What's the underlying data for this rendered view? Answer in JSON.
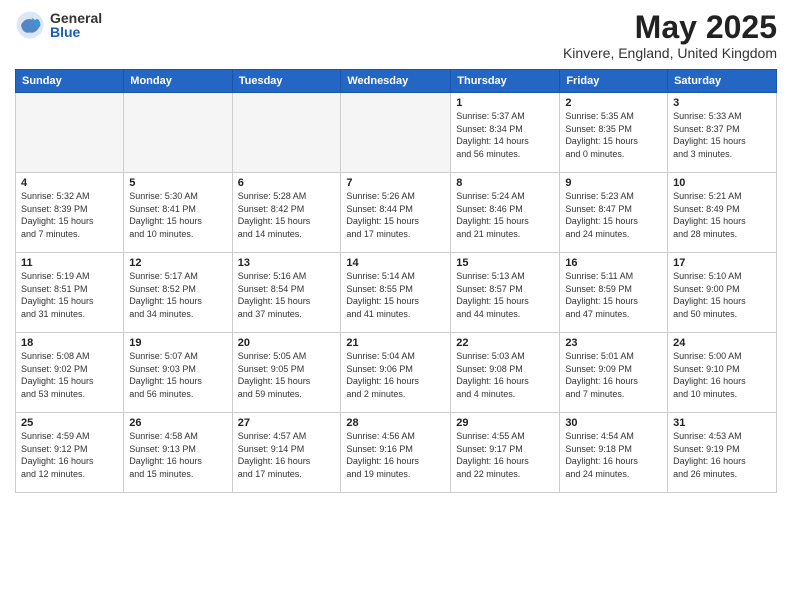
{
  "logo": {
    "general": "General",
    "blue": "Blue"
  },
  "title": {
    "month_year": "May 2025",
    "location": "Kinvere, England, United Kingdom"
  },
  "weekdays": [
    "Sunday",
    "Monday",
    "Tuesday",
    "Wednesday",
    "Thursday",
    "Friday",
    "Saturday"
  ],
  "weeks": [
    [
      {
        "day": "",
        "info": "",
        "empty": true
      },
      {
        "day": "",
        "info": "",
        "empty": true
      },
      {
        "day": "",
        "info": "",
        "empty": true
      },
      {
        "day": "",
        "info": "",
        "empty": true
      },
      {
        "day": "1",
        "info": "Sunrise: 5:37 AM\nSunset: 8:34 PM\nDaylight: 14 hours\nand 56 minutes.",
        "empty": false
      },
      {
        "day": "2",
        "info": "Sunrise: 5:35 AM\nSunset: 8:35 PM\nDaylight: 15 hours\nand 0 minutes.",
        "empty": false
      },
      {
        "day": "3",
        "info": "Sunrise: 5:33 AM\nSunset: 8:37 PM\nDaylight: 15 hours\nand 3 minutes.",
        "empty": false
      }
    ],
    [
      {
        "day": "4",
        "info": "Sunrise: 5:32 AM\nSunset: 8:39 PM\nDaylight: 15 hours\nand 7 minutes.",
        "empty": false
      },
      {
        "day": "5",
        "info": "Sunrise: 5:30 AM\nSunset: 8:41 PM\nDaylight: 15 hours\nand 10 minutes.",
        "empty": false
      },
      {
        "day": "6",
        "info": "Sunrise: 5:28 AM\nSunset: 8:42 PM\nDaylight: 15 hours\nand 14 minutes.",
        "empty": false
      },
      {
        "day": "7",
        "info": "Sunrise: 5:26 AM\nSunset: 8:44 PM\nDaylight: 15 hours\nand 17 minutes.",
        "empty": false
      },
      {
        "day": "8",
        "info": "Sunrise: 5:24 AM\nSunset: 8:46 PM\nDaylight: 15 hours\nand 21 minutes.",
        "empty": false
      },
      {
        "day": "9",
        "info": "Sunrise: 5:23 AM\nSunset: 8:47 PM\nDaylight: 15 hours\nand 24 minutes.",
        "empty": false
      },
      {
        "day": "10",
        "info": "Sunrise: 5:21 AM\nSunset: 8:49 PM\nDaylight: 15 hours\nand 28 minutes.",
        "empty": false
      }
    ],
    [
      {
        "day": "11",
        "info": "Sunrise: 5:19 AM\nSunset: 8:51 PM\nDaylight: 15 hours\nand 31 minutes.",
        "empty": false
      },
      {
        "day": "12",
        "info": "Sunrise: 5:17 AM\nSunset: 8:52 PM\nDaylight: 15 hours\nand 34 minutes.",
        "empty": false
      },
      {
        "day": "13",
        "info": "Sunrise: 5:16 AM\nSunset: 8:54 PM\nDaylight: 15 hours\nand 37 minutes.",
        "empty": false
      },
      {
        "day": "14",
        "info": "Sunrise: 5:14 AM\nSunset: 8:55 PM\nDaylight: 15 hours\nand 41 minutes.",
        "empty": false
      },
      {
        "day": "15",
        "info": "Sunrise: 5:13 AM\nSunset: 8:57 PM\nDaylight: 15 hours\nand 44 minutes.",
        "empty": false
      },
      {
        "day": "16",
        "info": "Sunrise: 5:11 AM\nSunset: 8:59 PM\nDaylight: 15 hours\nand 47 minutes.",
        "empty": false
      },
      {
        "day": "17",
        "info": "Sunrise: 5:10 AM\nSunset: 9:00 PM\nDaylight: 15 hours\nand 50 minutes.",
        "empty": false
      }
    ],
    [
      {
        "day": "18",
        "info": "Sunrise: 5:08 AM\nSunset: 9:02 PM\nDaylight: 15 hours\nand 53 minutes.",
        "empty": false
      },
      {
        "day": "19",
        "info": "Sunrise: 5:07 AM\nSunset: 9:03 PM\nDaylight: 15 hours\nand 56 minutes.",
        "empty": false
      },
      {
        "day": "20",
        "info": "Sunrise: 5:05 AM\nSunset: 9:05 PM\nDaylight: 15 hours\nand 59 minutes.",
        "empty": false
      },
      {
        "day": "21",
        "info": "Sunrise: 5:04 AM\nSunset: 9:06 PM\nDaylight: 16 hours\nand 2 minutes.",
        "empty": false
      },
      {
        "day": "22",
        "info": "Sunrise: 5:03 AM\nSunset: 9:08 PM\nDaylight: 16 hours\nand 4 minutes.",
        "empty": false
      },
      {
        "day": "23",
        "info": "Sunrise: 5:01 AM\nSunset: 9:09 PM\nDaylight: 16 hours\nand 7 minutes.",
        "empty": false
      },
      {
        "day": "24",
        "info": "Sunrise: 5:00 AM\nSunset: 9:10 PM\nDaylight: 16 hours\nand 10 minutes.",
        "empty": false
      }
    ],
    [
      {
        "day": "25",
        "info": "Sunrise: 4:59 AM\nSunset: 9:12 PM\nDaylight: 16 hours\nand 12 minutes.",
        "empty": false
      },
      {
        "day": "26",
        "info": "Sunrise: 4:58 AM\nSunset: 9:13 PM\nDaylight: 16 hours\nand 15 minutes.",
        "empty": false
      },
      {
        "day": "27",
        "info": "Sunrise: 4:57 AM\nSunset: 9:14 PM\nDaylight: 16 hours\nand 17 minutes.",
        "empty": false
      },
      {
        "day": "28",
        "info": "Sunrise: 4:56 AM\nSunset: 9:16 PM\nDaylight: 16 hours\nand 19 minutes.",
        "empty": false
      },
      {
        "day": "29",
        "info": "Sunrise: 4:55 AM\nSunset: 9:17 PM\nDaylight: 16 hours\nand 22 minutes.",
        "empty": false
      },
      {
        "day": "30",
        "info": "Sunrise: 4:54 AM\nSunset: 9:18 PM\nDaylight: 16 hours\nand 24 minutes.",
        "empty": false
      },
      {
        "day": "31",
        "info": "Sunrise: 4:53 AM\nSunset: 9:19 PM\nDaylight: 16 hours\nand 26 minutes.",
        "empty": false
      }
    ]
  ]
}
